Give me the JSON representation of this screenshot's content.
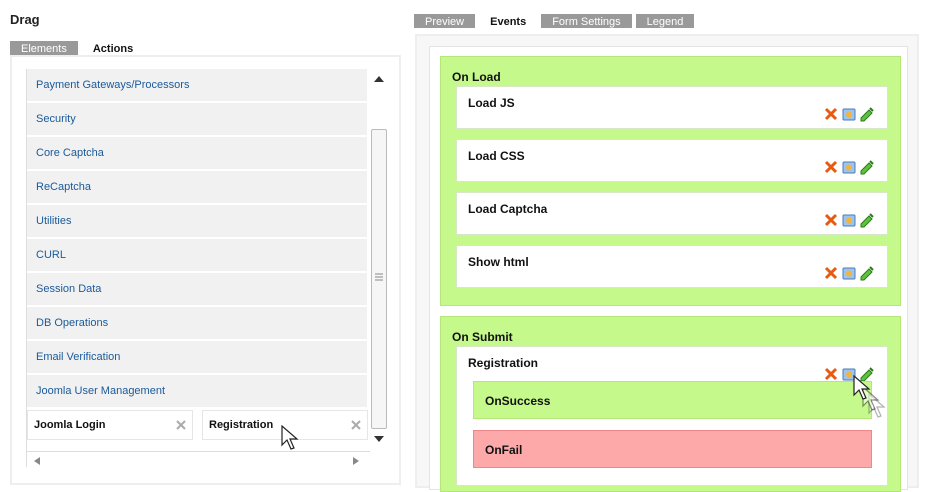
{
  "left": {
    "title": "Drag",
    "tabs": [
      {
        "label": "Elements",
        "active": false
      },
      {
        "label": "Actions",
        "active": true
      }
    ],
    "items": [
      {
        "label": "Payment Gateways/Processors"
      },
      {
        "label": "Security"
      },
      {
        "label": "Core Captcha"
      },
      {
        "label": "ReCaptcha"
      },
      {
        "label": "Utilities"
      },
      {
        "label": "CURL"
      },
      {
        "label": "Session Data"
      },
      {
        "label": "DB Operations"
      },
      {
        "label": "Email Verification"
      },
      {
        "label": "Joomla User Management"
      }
    ],
    "drag_items": [
      {
        "label": "Joomla Login"
      },
      {
        "label": "Registration"
      }
    ]
  },
  "right": {
    "tabs": [
      {
        "label": "Preview",
        "active": false
      },
      {
        "label": "Events",
        "active": true
      },
      {
        "label": "Form Settings",
        "active": false
      },
      {
        "label": "Legend",
        "active": false
      }
    ],
    "on_load": {
      "label": "On Load",
      "events": [
        {
          "label": "Load JS"
        },
        {
          "label": "Load CSS"
        },
        {
          "label": "Load Captcha"
        },
        {
          "label": "Show html"
        }
      ]
    },
    "on_submit": {
      "label": "On Submit",
      "event": {
        "label": "Registration"
      },
      "on_success": "OnSuccess",
      "on_fail": "OnFail"
    }
  },
  "colors": {
    "group_bg": "#c6f98b",
    "fail_bg": "#fea9a9",
    "link": "#1a5a9a",
    "tab_inactive": "#999999"
  },
  "icons": [
    "delete-icon",
    "settings-icon",
    "edit-icon",
    "move-icon",
    "scroll-up-icon",
    "scroll-down-icon",
    "scroll-left-icon",
    "scroll-right-icon",
    "cursor-icon"
  ]
}
